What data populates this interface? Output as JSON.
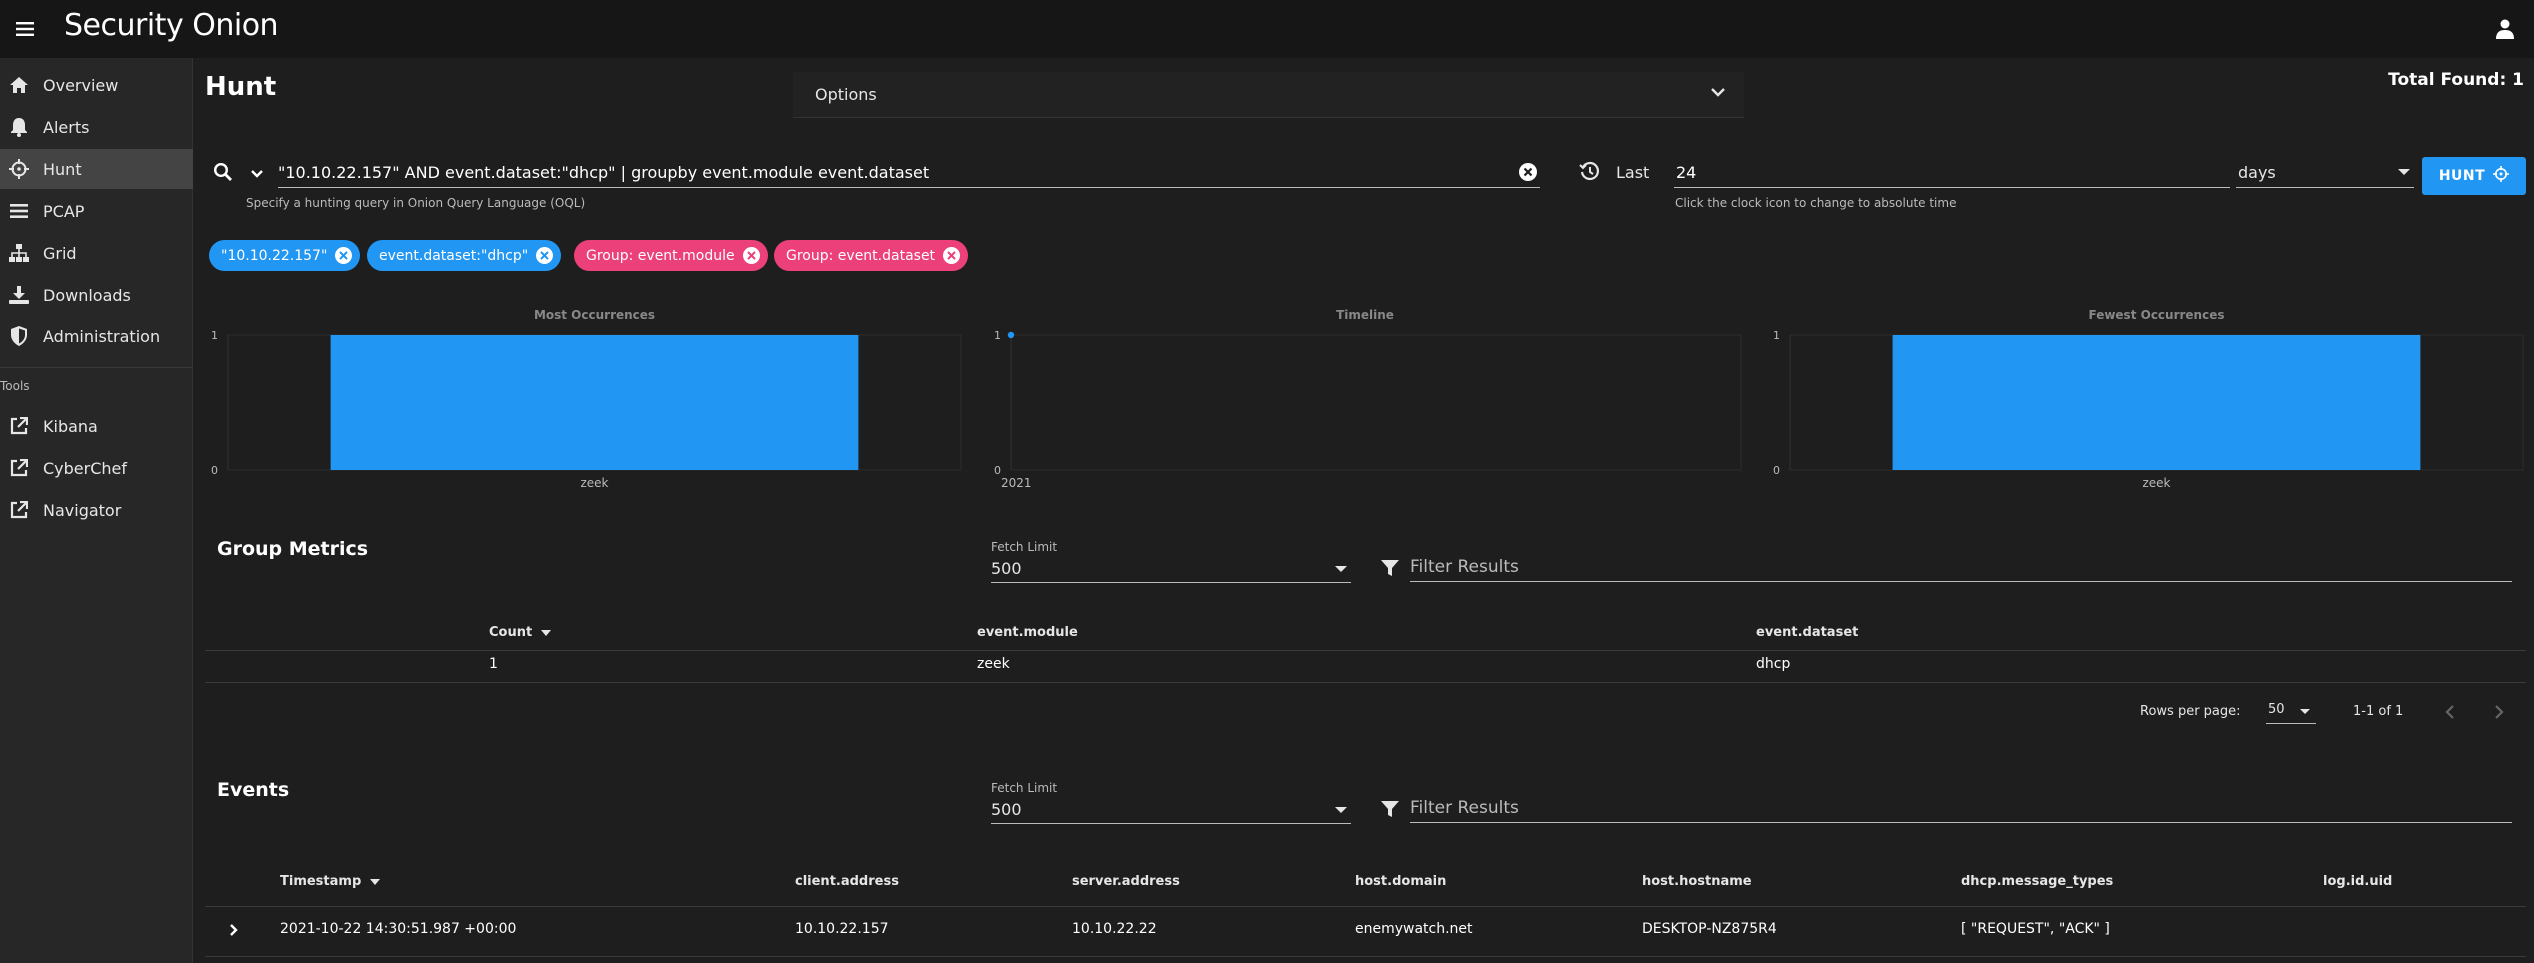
{
  "app": {
    "logo_text": "Security Onion"
  },
  "sidebar": {
    "items": [
      {
        "label": "Overview",
        "icon": "home-icon"
      },
      {
        "label": "Alerts",
        "icon": "bell-icon"
      },
      {
        "label": "Hunt",
        "icon": "crosshairs-icon",
        "active": true
      },
      {
        "label": "PCAP",
        "icon": "list-icon"
      },
      {
        "label": "Grid",
        "icon": "sitemap-icon"
      },
      {
        "label": "Downloads",
        "icon": "download-icon"
      },
      {
        "label": "Administration",
        "icon": "shield-icon"
      }
    ],
    "tools_heading": "Tools",
    "tools": [
      {
        "label": "Kibana",
        "icon": "external-link-icon"
      },
      {
        "label": "CyberChef",
        "icon": "external-link-icon"
      },
      {
        "label": "Navigator",
        "icon": "external-link-icon"
      }
    ]
  },
  "header": {
    "title": "Hunt",
    "options_label": "Options",
    "total_found": "Total Found: 1"
  },
  "query": {
    "value": "\"10.10.22.157\" AND event.dataset:\"dhcp\" | groupby event.module event.dataset",
    "hint": "Specify a hunting query in Onion Query Language (OQL)"
  },
  "time": {
    "last_label": "Last",
    "value": "24",
    "hint": "Click the clock icon to change to absolute time",
    "unit": "days"
  },
  "hunt_button": "HUNT",
  "chips": [
    {
      "label": "\"10.10.22.157\"",
      "color": "#2196f3"
    },
    {
      "label": "event.dataset:\"dhcp\"",
      "color": "#2196f3"
    },
    {
      "label": "Group: event.module",
      "color": "#ec407a"
    },
    {
      "label": "Group: event.dataset",
      "color": "#ec407a"
    }
  ],
  "chart_data": [
    {
      "type": "bar",
      "title": "Most Occurrences",
      "categories": [
        "zeek"
      ],
      "values": [
        1
      ],
      "ylim": [
        0,
        1
      ],
      "yticks": [
        "0",
        "1"
      ],
      "color": "#2196f3",
      "grid": true
    },
    {
      "type": "scatter",
      "title": "Timeline",
      "x": [
        "2021"
      ],
      "values": [
        1
      ],
      "ylim": [
        0,
        1
      ],
      "yticks": [
        "0",
        "1"
      ],
      "color": "#2196f3",
      "grid": true
    },
    {
      "type": "bar",
      "title": "Fewest Occurrences",
      "categories": [
        "zeek"
      ],
      "values": [
        1
      ],
      "ylim": [
        0,
        1
      ],
      "yticks": [
        "0",
        "1"
      ],
      "color": "#2196f3",
      "grid": true
    }
  ],
  "group_metrics": {
    "title": "Group Metrics",
    "fetch_label": "Fetch Limit",
    "fetch_value": "500",
    "filter_placeholder": "Filter Results",
    "headers": [
      "Count",
      "event.module",
      "event.dataset"
    ],
    "rows": [
      [
        "1",
        "zeek",
        "dhcp"
      ]
    ],
    "rows_per_page_label": "Rows per page:",
    "rows_per_page": "50",
    "range": "1-1 of 1"
  },
  "events": {
    "title": "Events",
    "fetch_label": "Fetch Limit",
    "fetch_value": "500",
    "filter_placeholder": "Filter Results",
    "headers": [
      "Timestamp",
      "client.address",
      "server.address",
      "host.domain",
      "host.hostname",
      "dhcp.message_types",
      "log.id.uid"
    ],
    "rows": [
      [
        "2021-10-22 14:30:51.987 +00:00",
        "10.10.22.157",
        "10.10.22.22",
        "enemywatch.net",
        "DESKTOP-NZ875R4",
        "[ \"REQUEST\", \"ACK\" ]",
        ""
      ]
    ]
  }
}
